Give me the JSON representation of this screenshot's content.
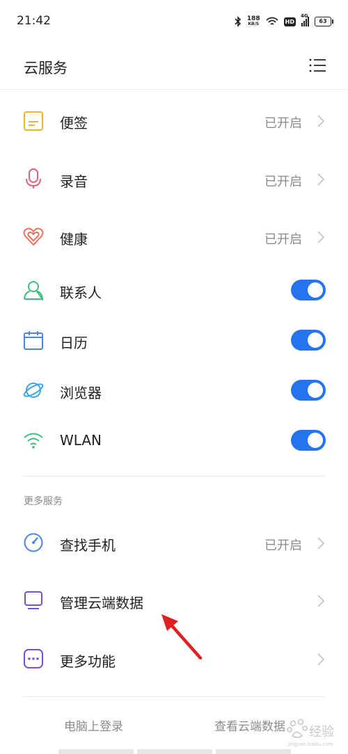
{
  "status_bar": {
    "time": "21:42",
    "speed_value": "188",
    "speed_unit": "KB/S",
    "hd": "HD",
    "network": "4G",
    "battery": "63"
  },
  "header": {
    "title": "云服务",
    "menu_icon": "list-menu-icon"
  },
  "sync_items": [
    {
      "label": "便签",
      "status": "已开启",
      "icon": "notes-icon",
      "color": "#e9b632"
    },
    {
      "label": "录音",
      "status": "已开启",
      "icon": "microphone-icon",
      "color": "#e0637b"
    },
    {
      "label": "健康",
      "status": "已开启",
      "icon": "health-heart-icon",
      "color": "#e8735a"
    },
    {
      "label": "联系人",
      "toggle_on": true,
      "icon": "contacts-icon",
      "color": "#3dbd7d"
    },
    {
      "label": "日历",
      "toggle_on": true,
      "icon": "calendar-icon",
      "color": "#4a86e8"
    },
    {
      "label": "浏览器",
      "toggle_on": true,
      "icon": "browser-icon",
      "color": "#3aa6e0"
    },
    {
      "label": "WLAN",
      "toggle_on": true,
      "icon": "wifi-icon",
      "color": "#3dbd7d"
    }
  ],
  "more_section": {
    "header": "更多服务",
    "items": [
      {
        "label": "查找手机",
        "status": "已开启",
        "icon": "find-phone-icon",
        "color": "#4a86e8"
      },
      {
        "label": "管理云端数据",
        "icon": "manage-data-icon",
        "color": "#7b4fc9"
      },
      {
        "label": "更多功能",
        "icon": "more-functions-icon",
        "color": "#7b4fc9"
      }
    ]
  },
  "bottom": {
    "pc_login": "电脑上登录",
    "view_cloud_data": "查看云端数据"
  },
  "colors": {
    "accent": "#2473f0",
    "annotation_arrow": "#e02020"
  },
  "watermark": {
    "text": "经验",
    "subtext": "jingyan.baidu.com"
  }
}
